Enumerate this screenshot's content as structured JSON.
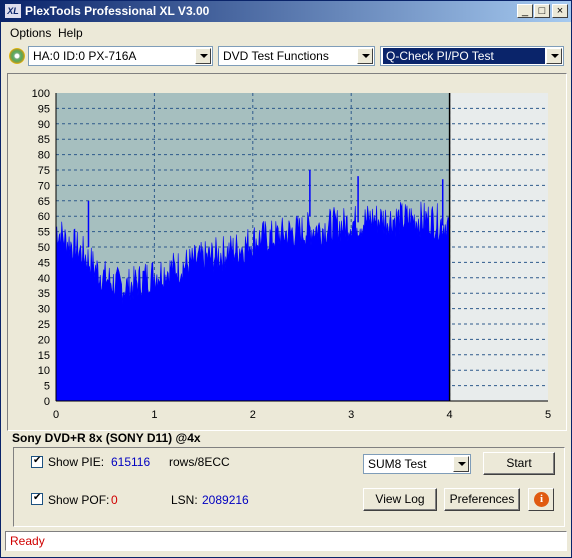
{
  "app": {
    "title": "PlexTools Professional XL V3.00",
    "icon_text": "XL",
    "window_controls": [
      "_",
      "□",
      "×"
    ]
  },
  "menu": [
    "Options",
    "Help"
  ],
  "toolbar": {
    "drive": "HA:0 ID:0  PX-716A",
    "functions": "DVD Test Functions",
    "test": "Q-Check PI/PO Test"
  },
  "chart_data": {
    "type": "area",
    "x_ticks": [
      "0",
      "1",
      "2",
      "3",
      "4",
      "5"
    ],
    "y_ticks": [
      "0",
      "5",
      "10",
      "15",
      "20",
      "25",
      "30",
      "35",
      "40",
      "45",
      "50",
      "55",
      "60",
      "65",
      "70",
      "75",
      "80",
      "85",
      "90",
      "95",
      "100"
    ],
    "xlim": [
      0,
      5
    ],
    "ylim": [
      0,
      100
    ],
    "grid": true,
    "series": [
      {
        "color": "#0000ff",
        "x": [
          0,
          0.1,
          0.2,
          0.3,
          0.4,
          0.5,
          0.6,
          0.7,
          0.8,
          0.9,
          1.0,
          1.1,
          1.2,
          1.3,
          1.4,
          1.5,
          1.6,
          1.7,
          1.8,
          1.9,
          2.0,
          2.1,
          2.2,
          2.3,
          2.4,
          2.5,
          2.6,
          2.7,
          2.8,
          2.9,
          3.0,
          3.1,
          3.2,
          3.3,
          3.4,
          3.5,
          3.6,
          3.7,
          3.8,
          3.9,
          4.0
        ],
        "y": [
          56,
          52,
          50,
          47,
          43,
          40,
          38,
          37,
          38,
          40,
          41,
          42,
          43,
          44,
          45,
          46,
          47,
          48,
          49,
          50,
          52,
          53,
          53,
          54,
          55,
          55,
          56,
          56,
          57,
          57,
          58,
          58,
          59,
          59,
          59,
          59,
          59,
          59,
          59,
          58,
          57
        ]
      }
    ],
    "peaks": [
      {
        "x": 0.33,
        "y": 65
      },
      {
        "x": 2.58,
        "y": 75
      },
      {
        "x": 3.07,
        "y": 73
      },
      {
        "x": 3.93,
        "y": 72
      }
    ]
  },
  "disc": "Sony DVD+R 8x (SONY D11) @4x",
  "controls": {
    "show_pie": "Show PIE:",
    "pie_value": "615116",
    "rows_label": "rows/8ECC",
    "show_pof": "Show POF:",
    "pof_value": "0",
    "lsn_label": "LSN:",
    "lsn_value": "2089216",
    "sum_select": "SUM8 Test",
    "start": "Start",
    "view_log": "View Log",
    "preferences": "Preferences"
  },
  "status": "Ready"
}
